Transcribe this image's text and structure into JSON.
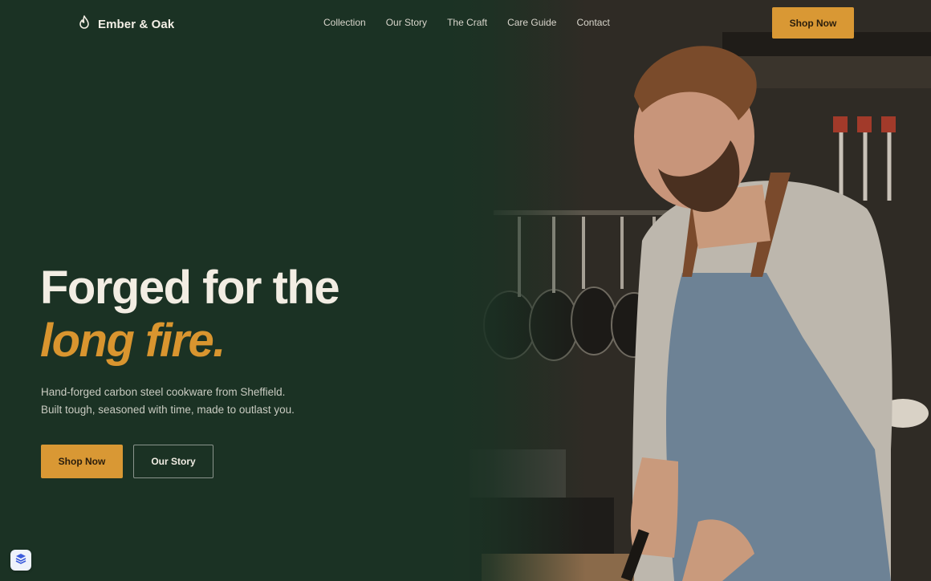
{
  "brand": {
    "name": "Ember & Oak",
    "icon": "flame-icon"
  },
  "nav": {
    "items": [
      {
        "label": "Collection"
      },
      {
        "label": "Our Story"
      },
      {
        "label": "The Craft"
      },
      {
        "label": "Care Guide"
      },
      {
        "label": "Contact"
      }
    ],
    "cta_label": "Shop Now"
  },
  "hero": {
    "headline_line1": "Forged for the",
    "headline_accent": "long fire.",
    "subtitle_line1": "Hand-forged carbon steel cookware from Sheffield.",
    "subtitle_line2": "Built tough, seasoned with time, made to outlast you.",
    "primary_label": "Shop Now",
    "secondary_label": "Our Story",
    "image": "chef-slicing-in-kitchen"
  },
  "widget": {
    "icon": "layers-icon"
  },
  "colors": {
    "background": "#1b3224",
    "accent": "#d99834",
    "headline": "#f2ede3",
    "body_text": "#c9cbc1"
  }
}
